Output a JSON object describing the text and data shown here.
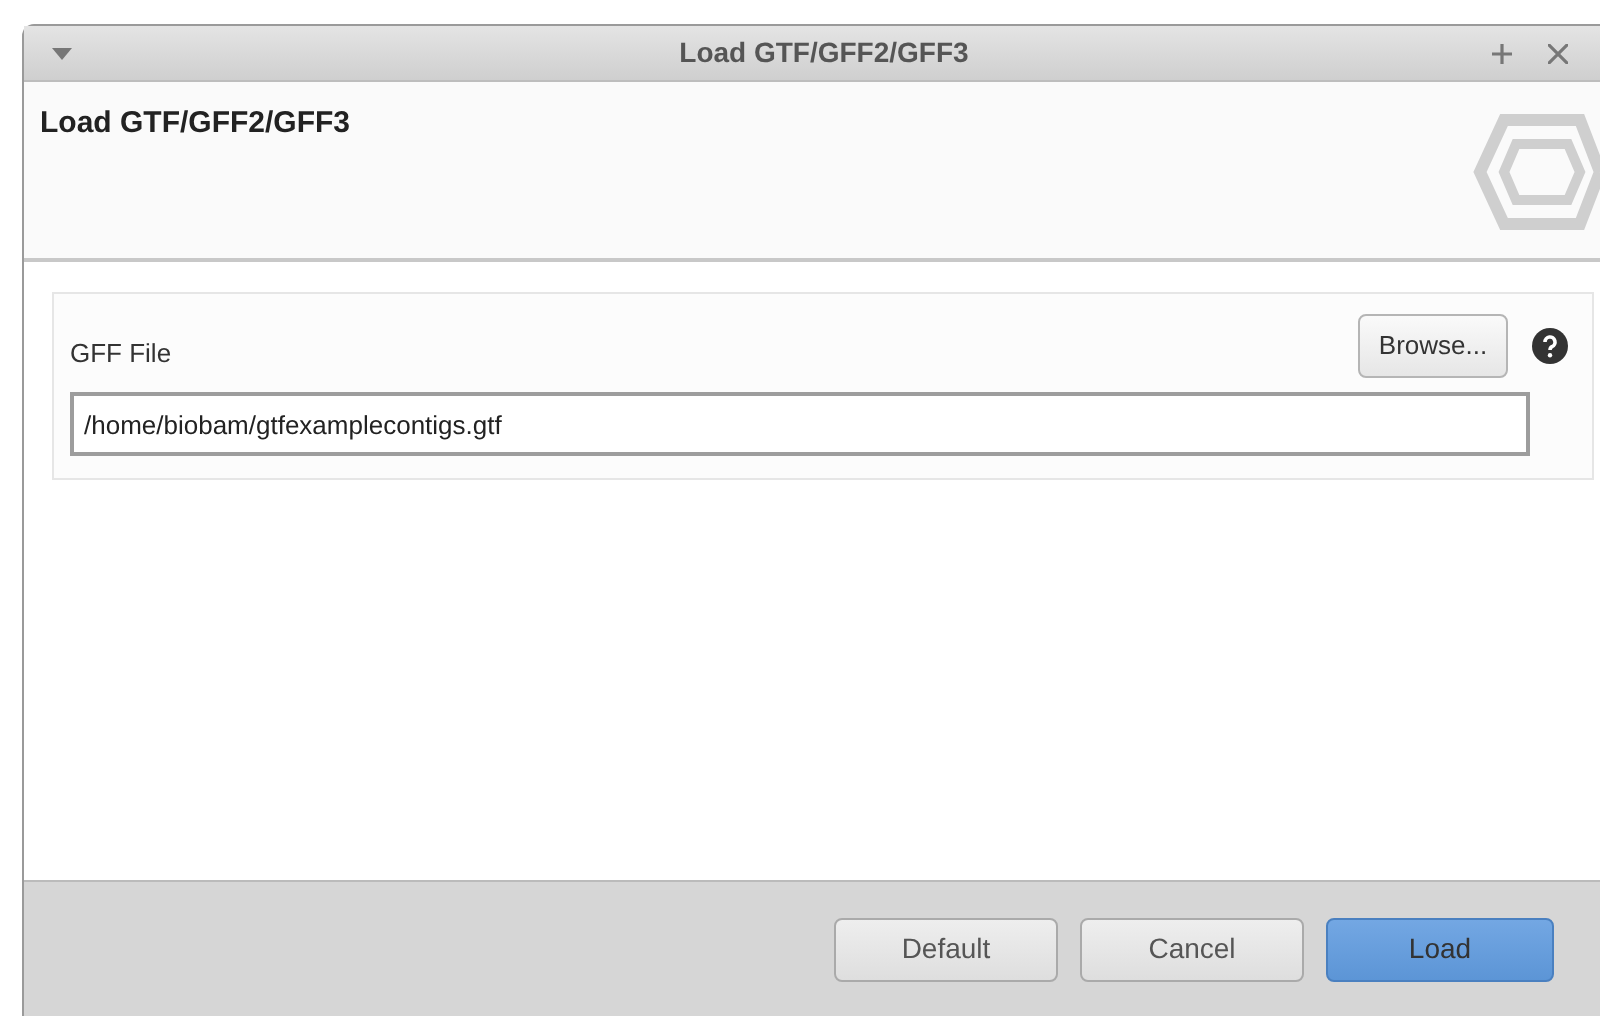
{
  "window": {
    "title": "Load GTF/GFF2/GFF3"
  },
  "header": {
    "title": "Load GTF/GFF2/GFF3"
  },
  "form": {
    "label": "GFF File",
    "browse_button": "Browse...",
    "value": "/home/biobam/gtfexamplecontigs.gtf"
  },
  "buttons": [
    {
      "label": "Default",
      "kind": "normal"
    },
    {
      "label": "Cancel",
      "kind": "normal"
    },
    {
      "label": "Load",
      "kind": "primary"
    }
  ]
}
